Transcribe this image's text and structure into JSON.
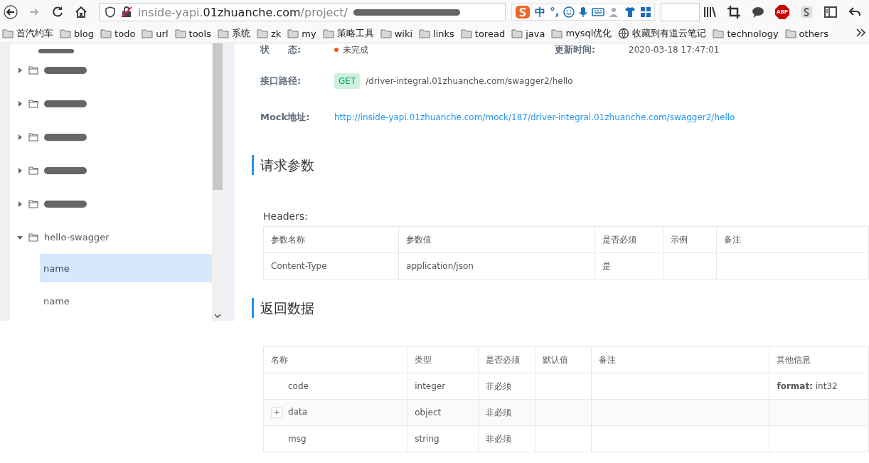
{
  "browser": {
    "url_sub": "inside-yapi.",
    "url_host": "01zhuanche.com",
    "url_path": "/project/",
    "ime": {
      "mode": "中",
      "punct": "°,"
    },
    "adblock_badge": "ABP"
  },
  "bookmarks": [
    {
      "kind": "folder",
      "label": "首汽约车"
    },
    {
      "kind": "folder",
      "label": "blog"
    },
    {
      "kind": "folder",
      "label": "todo"
    },
    {
      "kind": "folder",
      "label": "url"
    },
    {
      "kind": "folder",
      "label": "tools"
    },
    {
      "kind": "folder",
      "label": "系统"
    },
    {
      "kind": "folder",
      "label": "zk"
    },
    {
      "kind": "folder",
      "label": "my"
    },
    {
      "kind": "folder",
      "label": "策略工具"
    },
    {
      "kind": "folder",
      "label": "wiki"
    },
    {
      "kind": "folder",
      "label": "links"
    },
    {
      "kind": "folder",
      "label": "toread"
    },
    {
      "kind": "folder",
      "label": "java"
    },
    {
      "kind": "folder",
      "label": "mysql优化"
    },
    {
      "kind": "web",
      "label": "收藏到有道云笔记"
    },
    {
      "kind": "folder",
      "label": "technology"
    },
    {
      "kind": "folder",
      "label": "others"
    }
  ],
  "sidebar": {
    "folders": [
      {
        "expanded": false
      },
      {
        "expanded": false
      },
      {
        "expanded": false
      },
      {
        "expanded": false
      },
      {
        "expanded": false
      },
      {
        "label": "hello-swagger",
        "expanded": true,
        "children": [
          {
            "label": "name",
            "selected": true
          },
          {
            "label": "name",
            "selected": false
          }
        ]
      }
    ]
  },
  "info": {
    "status_label": "状　　态:",
    "status": "未完成",
    "updated_label": "更新时间:",
    "updated": "2020-03-18 17:47:01",
    "path_label": "接口路径:",
    "method": "GET",
    "path": "/driver-integral.01zhuanche.com/swagger2/hello",
    "mock_label": "Mock地址:",
    "mock_url": "http://inside-yapi.01zhuanche.com/mock/187/driver-integral.01zhuanche.com/swagger2/hello"
  },
  "request": {
    "title": "请求参数",
    "headers_label": "Headers:",
    "columns": [
      "参数名称",
      "参数值",
      "是否必须",
      "示例",
      "备注"
    ],
    "rows": [
      [
        "Content-Type",
        "application/json",
        "是",
        "",
        ""
      ]
    ]
  },
  "response": {
    "title": "返回数据",
    "columns": [
      "名称",
      "类型",
      "是否必须",
      "默认值",
      "备注",
      "其他信息"
    ],
    "rows": [
      {
        "expandable": false,
        "cells": [
          "code",
          "integer",
          "非必须",
          "",
          "",
          "**format:** int32"
        ]
      },
      {
        "expandable": true,
        "expand_sign": "+",
        "cells": [
          "data",
          "object",
          "非必须",
          "",
          "",
          ""
        ]
      },
      {
        "expandable": false,
        "cells": [
          "msg",
          "string",
          "非必须",
          "",
          "",
          ""
        ]
      }
    ]
  }
}
